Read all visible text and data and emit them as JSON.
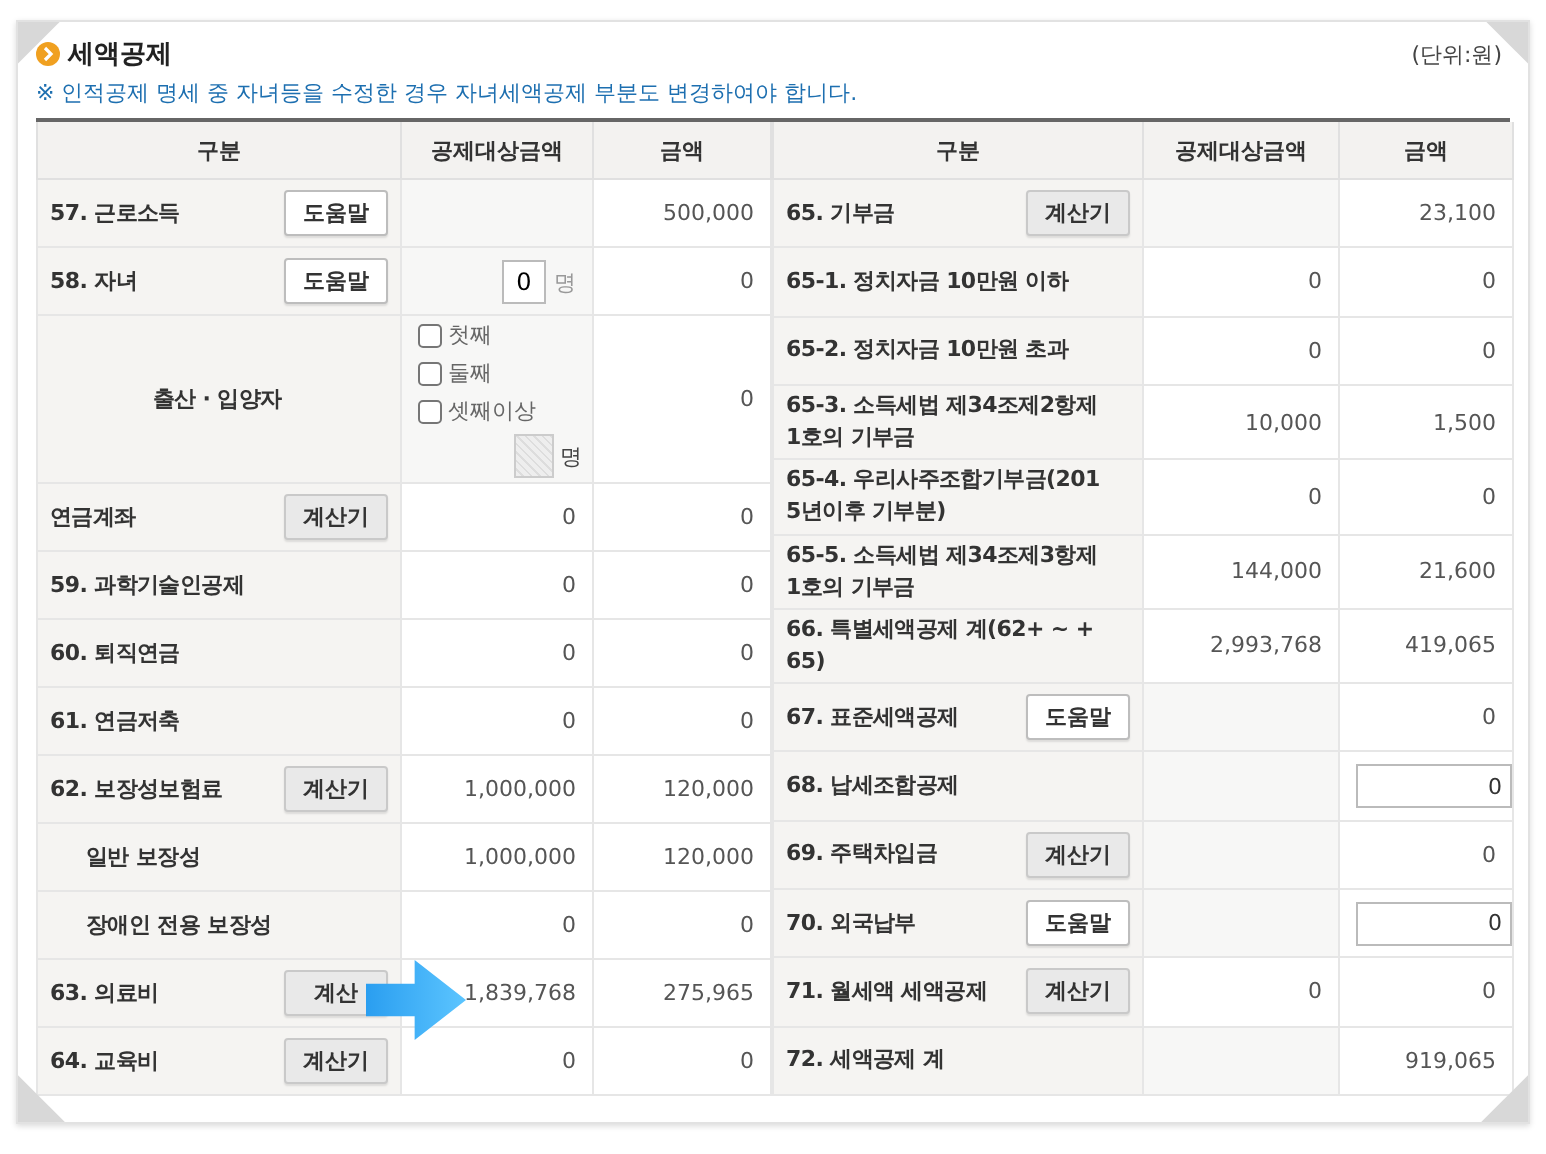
{
  "title": "세액공제",
  "unit": "(단위:원)",
  "notice": "※ 인적공제 명세 중 자녀등을 수정한 경우 자녀세액공제 부분도 변경하여야 합니다.",
  "left": {
    "columns": [
      "구분",
      "공제대상금액",
      "금액"
    ],
    "rows": [
      {
        "label": "57. 근로소득",
        "button": {
          "kind": "help",
          "text": "도움말"
        },
        "amount": "500,000"
      },
      {
        "label": "58. 자녀",
        "button": {
          "kind": "help",
          "text": "도움말"
        },
        "target_input": {
          "value": "0",
          "unit": "명"
        },
        "amount": "0",
        "children": [
          {
            "label": "출산 · 입양자",
            "options": [
              {
                "label": "첫째",
                "checked": false
              },
              {
                "label": "둘째",
                "checked": false
              },
              {
                "label": "셋째이상",
                "checked": false
              }
            ],
            "extra_unit": "명",
            "amount": "0"
          }
        ]
      },
      {
        "label": "연금계좌",
        "button": {
          "kind": "calc",
          "text": "계산기"
        },
        "target": "0",
        "amount": "0"
      },
      {
        "label": "59. 과학기술인공제",
        "target": "0",
        "amount": "0"
      },
      {
        "label": "60. 퇴직연금",
        "target": "0",
        "amount": "0"
      },
      {
        "label": "61. 연금저축",
        "target": "0",
        "amount": "0"
      },
      {
        "label": "62. 보장성보험료",
        "button": {
          "kind": "calc",
          "text": "계산기"
        },
        "target": "1,000,000",
        "amount": "120,000",
        "children": [
          {
            "label": "일반 보장성",
            "target": "1,000,000",
            "amount": "120,000"
          },
          {
            "label": "장애인 전용 보장성",
            "target": "0",
            "amount": "0"
          }
        ]
      },
      {
        "label": "63. 의료비",
        "button": {
          "kind": "calc",
          "text": "계산"
        },
        "arrow": true,
        "target": "1,839,768",
        "amount": "275,965"
      },
      {
        "label": "64. 교육비",
        "button": {
          "kind": "calc",
          "text": "계산기"
        },
        "target": "0",
        "amount": "0"
      }
    ]
  },
  "right": {
    "columns": [
      "구분",
      "공제대상금액",
      "금액"
    ],
    "rows": [
      {
        "label": "65. 기부금",
        "button": {
          "kind": "calc",
          "text": "계산기"
        },
        "amount": "23,100"
      },
      {
        "label": "65-1. 정치자금 10만원 이하",
        "target": "0",
        "amount": "0"
      },
      {
        "label": "65-2. 정치자금 10만원 초과",
        "target": "0",
        "amount": "0"
      },
      {
        "label": "65-3. 소득세법 제34조제2항제\n1호의 기부금",
        "target": "10,000",
        "amount": "1,500"
      },
      {
        "label": "65-4. 우리사주조합기부금(201\n5년이후 기부분)",
        "target": "0",
        "amount": "0"
      },
      {
        "label": "65-5. 소득세법 제34조제3항제\n1호의 기부금",
        "target": "144,000",
        "amount": "21,600"
      },
      {
        "label": "66. 특별세액공제 계(62+ ~ +\n65)",
        "target": "2,993,768",
        "amount": "419,065"
      },
      {
        "label": "67. 표준세액공제",
        "button": {
          "kind": "help",
          "text": "도움말"
        },
        "amount": "0"
      },
      {
        "label": "68. 납세조합공제",
        "amount": "0",
        "amount_input": true
      },
      {
        "label": "69. 주택차입금",
        "button": {
          "kind": "calc",
          "text": "계산기"
        },
        "amount": "0"
      },
      {
        "label": "70. 외국납부",
        "button": {
          "kind": "help",
          "text": "도움말"
        },
        "amount": "0",
        "amount_input": true
      },
      {
        "label": "71. 월세액 세액공제",
        "button": {
          "kind": "calc",
          "text": "계산기"
        },
        "target": "0",
        "amount": "0"
      },
      {
        "label": "72. 세액공제 계",
        "amount": "919,065"
      }
    ]
  }
}
